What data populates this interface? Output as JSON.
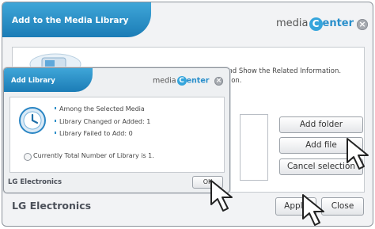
{
  "main_dialog": {
    "title": "Add to the Media Library",
    "logo": {
      "media": "media",
      "c": "C",
      "rest": "enter"
    },
    "instruction": "Search the Media Files in the Computer and Show the Related Information. Select the Media, Click on the Search Button.",
    "buttons": {
      "add_folder": "Add folder",
      "add_file": "Add file",
      "cancel_selection": "Cancel selection",
      "apply": "Apply",
      "close": "Close"
    },
    "footer": "LG Electronics",
    "close_glyph": "×"
  },
  "sub_dialog": {
    "title": "Add Library",
    "logo": {
      "media": "media",
      "c": "C",
      "rest": "enter"
    },
    "lines": [
      "Among the Selected Media",
      "Library Changed or Added: 1",
      "Library Failed to Add: 0"
    ],
    "total": "Currently Total Number of Library is 1.",
    "ok": "OK",
    "footer": "LG Electronics",
    "close_glyph": "×"
  },
  "colors": {
    "accent": "#2a8fcb",
    "title_bar": "#1b7cb6",
    "logo_c": "#35a5dc"
  }
}
